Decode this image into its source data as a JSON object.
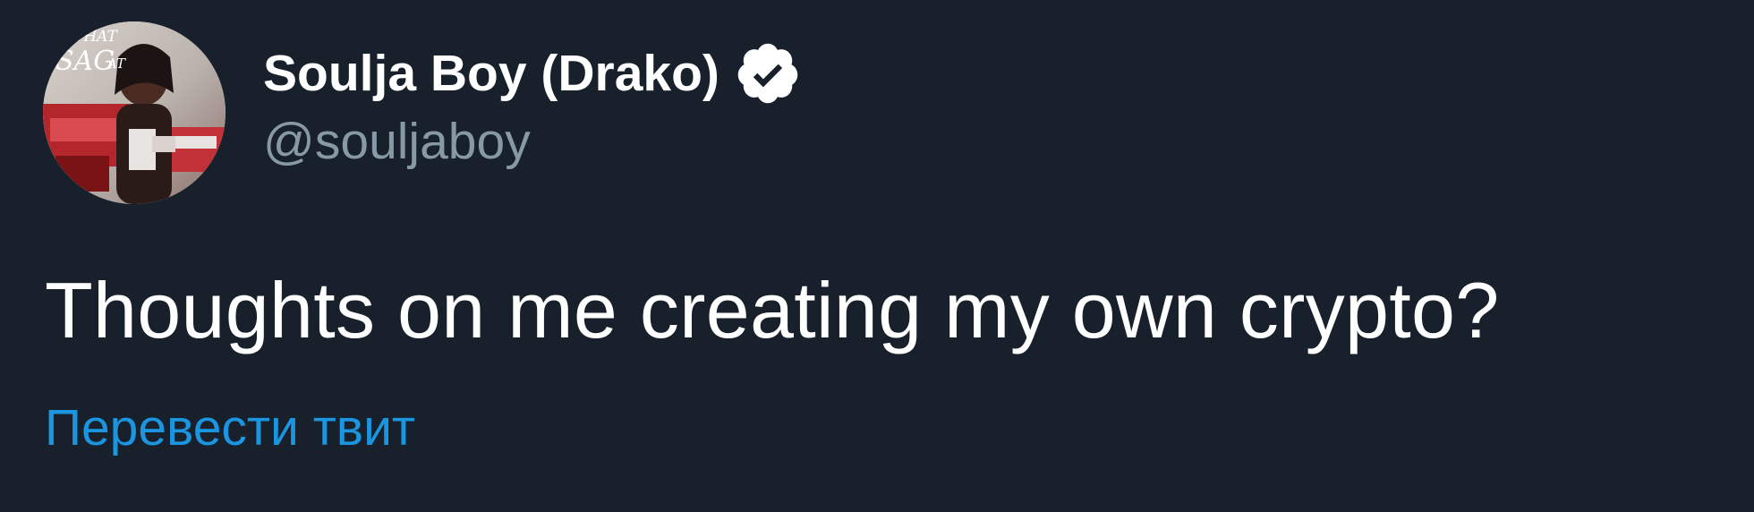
{
  "tweet": {
    "author": {
      "display_name": "Soulja Boy (Drako)",
      "handle": "@souljaboy",
      "verified": true,
      "avatar_overlay_text": "THAT SAG AT"
    },
    "text": "Thoughts on me creating my own crypto?",
    "translate_label": "Перевести твит"
  },
  "theme": {
    "background": "#17202b",
    "name_color": "#ffffff",
    "handle_color": "#8899a6",
    "link_color": "#1b95e0"
  }
}
